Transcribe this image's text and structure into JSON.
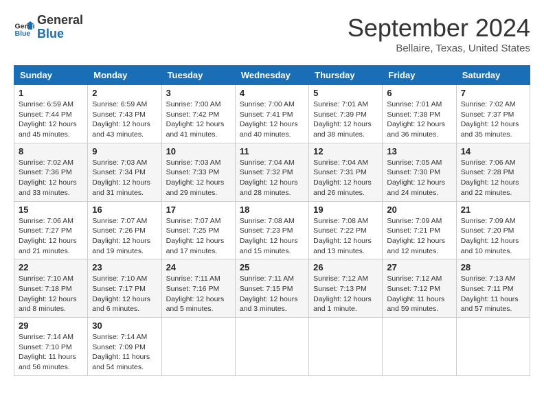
{
  "header": {
    "logo_line1": "General",
    "logo_line2": "Blue",
    "month_title": "September 2024",
    "location": "Bellaire, Texas, United States"
  },
  "calendar": {
    "headers": [
      "Sunday",
      "Monday",
      "Tuesday",
      "Wednesday",
      "Thursday",
      "Friday",
      "Saturday"
    ],
    "weeks": [
      [
        {
          "day": "1",
          "sunrise": "6:59 AM",
          "sunset": "7:44 PM",
          "daylight": "12 hours and 45 minutes."
        },
        {
          "day": "2",
          "sunrise": "6:59 AM",
          "sunset": "7:43 PM",
          "daylight": "12 hours and 43 minutes."
        },
        {
          "day": "3",
          "sunrise": "7:00 AM",
          "sunset": "7:42 PM",
          "daylight": "12 hours and 41 minutes."
        },
        {
          "day": "4",
          "sunrise": "7:00 AM",
          "sunset": "7:41 PM",
          "daylight": "12 hours and 40 minutes."
        },
        {
          "day": "5",
          "sunrise": "7:01 AM",
          "sunset": "7:39 PM",
          "daylight": "12 hours and 38 minutes."
        },
        {
          "day": "6",
          "sunrise": "7:01 AM",
          "sunset": "7:38 PM",
          "daylight": "12 hours and 36 minutes."
        },
        {
          "day": "7",
          "sunrise": "7:02 AM",
          "sunset": "7:37 PM",
          "daylight": "12 hours and 35 minutes."
        }
      ],
      [
        {
          "day": "8",
          "sunrise": "7:02 AM",
          "sunset": "7:36 PM",
          "daylight": "12 hours and 33 minutes."
        },
        {
          "day": "9",
          "sunrise": "7:03 AM",
          "sunset": "7:34 PM",
          "daylight": "12 hours and 31 minutes."
        },
        {
          "day": "10",
          "sunrise": "7:03 AM",
          "sunset": "7:33 PM",
          "daylight": "12 hours and 29 minutes."
        },
        {
          "day": "11",
          "sunrise": "7:04 AM",
          "sunset": "7:32 PM",
          "daylight": "12 hours and 28 minutes."
        },
        {
          "day": "12",
          "sunrise": "7:04 AM",
          "sunset": "7:31 PM",
          "daylight": "12 hours and 26 minutes."
        },
        {
          "day": "13",
          "sunrise": "7:05 AM",
          "sunset": "7:30 PM",
          "daylight": "12 hours and 24 minutes."
        },
        {
          "day": "14",
          "sunrise": "7:06 AM",
          "sunset": "7:28 PM",
          "daylight": "12 hours and 22 minutes."
        }
      ],
      [
        {
          "day": "15",
          "sunrise": "7:06 AM",
          "sunset": "7:27 PM",
          "daylight": "12 hours and 21 minutes."
        },
        {
          "day": "16",
          "sunrise": "7:07 AM",
          "sunset": "7:26 PM",
          "daylight": "12 hours and 19 minutes."
        },
        {
          "day": "17",
          "sunrise": "7:07 AM",
          "sunset": "7:25 PM",
          "daylight": "12 hours and 17 minutes."
        },
        {
          "day": "18",
          "sunrise": "7:08 AM",
          "sunset": "7:23 PM",
          "daylight": "12 hours and 15 minutes."
        },
        {
          "day": "19",
          "sunrise": "7:08 AM",
          "sunset": "7:22 PM",
          "daylight": "12 hours and 13 minutes."
        },
        {
          "day": "20",
          "sunrise": "7:09 AM",
          "sunset": "7:21 PM",
          "daylight": "12 hours and 12 minutes."
        },
        {
          "day": "21",
          "sunrise": "7:09 AM",
          "sunset": "7:20 PM",
          "daylight": "12 hours and 10 minutes."
        }
      ],
      [
        {
          "day": "22",
          "sunrise": "7:10 AM",
          "sunset": "7:18 PM",
          "daylight": "12 hours and 8 minutes."
        },
        {
          "day": "23",
          "sunrise": "7:10 AM",
          "sunset": "7:17 PM",
          "daylight": "12 hours and 6 minutes."
        },
        {
          "day": "24",
          "sunrise": "7:11 AM",
          "sunset": "7:16 PM",
          "daylight": "12 hours and 5 minutes."
        },
        {
          "day": "25",
          "sunrise": "7:11 AM",
          "sunset": "7:15 PM",
          "daylight": "12 hours and 3 minutes."
        },
        {
          "day": "26",
          "sunrise": "7:12 AM",
          "sunset": "7:13 PM",
          "daylight": "12 hours and 1 minute."
        },
        {
          "day": "27",
          "sunrise": "7:12 AM",
          "sunset": "7:12 PM",
          "daylight": "11 hours and 59 minutes."
        },
        {
          "day": "28",
          "sunrise": "7:13 AM",
          "sunset": "7:11 PM",
          "daylight": "11 hours and 57 minutes."
        }
      ],
      [
        {
          "day": "29",
          "sunrise": "7:14 AM",
          "sunset": "7:10 PM",
          "daylight": "11 hours and 56 minutes."
        },
        {
          "day": "30",
          "sunrise": "7:14 AM",
          "sunset": "7:09 PM",
          "daylight": "11 hours and 54 minutes."
        },
        null,
        null,
        null,
        null,
        null
      ]
    ]
  }
}
